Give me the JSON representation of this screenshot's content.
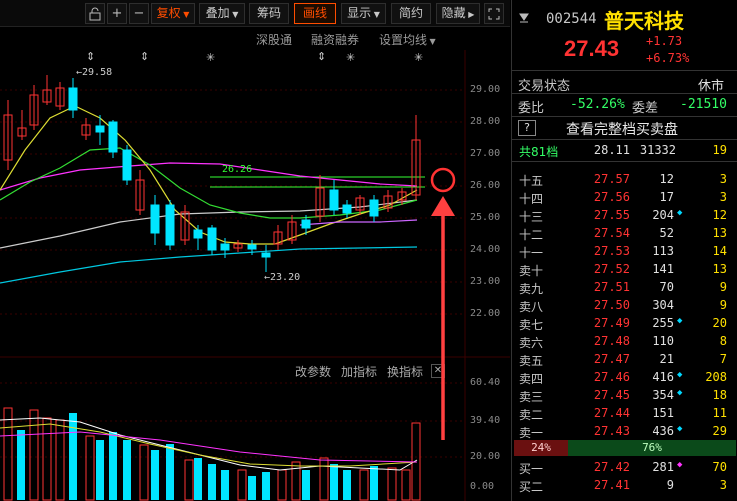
{
  "toolbar": {
    "buttons": [
      "复权",
      "叠加",
      "筹码",
      "画线",
      "显示",
      "简约",
      "隐藏"
    ],
    "active": "画线",
    "sub_buttons": [
      "深股通",
      "融资融券",
      "设置均线"
    ]
  },
  "price_axis": [
    "29.00",
    "28.00",
    "27.00",
    "26.00",
    "25.00",
    "24.00",
    "23.00",
    "22.00"
  ],
  "volume_axis": [
    "60.40",
    "39.40",
    "20.00",
    "0.00"
  ],
  "chart_annotations": {
    "high": "←29.58",
    "low": "←23.20",
    "line_level": "26.26"
  },
  "indicator_buttons": [
    "改参数",
    "加指标",
    "换指标"
  ],
  "stock": {
    "code": "002544",
    "name": "普天科技",
    "price": "27.43",
    "change": "+1.73",
    "change_pct": "+6.73%"
  },
  "status": {
    "label": "交易状态",
    "value": "休市"
  },
  "ratio": {
    "label": "委比",
    "value": "-52.26%",
    "diff_label": "委差",
    "diff_value": "-21510"
  },
  "full_orderbook_link": "查看完整档买卖盘",
  "total": {
    "label": "共81档",
    "price": "28.11",
    "volume": "31332",
    "count": "19"
  },
  "asks": [
    {
      "label": "十五",
      "price": "27.57",
      "vol": "12",
      "mark": "",
      "count": "3"
    },
    {
      "label": "十四",
      "price": "27.56",
      "vol": "17",
      "mark": "",
      "count": "3"
    },
    {
      "label": "十三",
      "price": "27.55",
      "vol": "204",
      "mark": "◆",
      "count": "12"
    },
    {
      "label": "十二",
      "price": "27.54",
      "vol": "52",
      "mark": "",
      "count": "13"
    },
    {
      "label": "十一",
      "price": "27.53",
      "vol": "113",
      "mark": "",
      "count": "14"
    },
    {
      "label": "卖十",
      "price": "27.52",
      "vol": "141",
      "mark": "",
      "count": "13"
    },
    {
      "label": "卖九",
      "price": "27.51",
      "vol": "70",
      "mark": "",
      "count": "9"
    },
    {
      "label": "卖八",
      "price": "27.50",
      "vol": "304",
      "mark": "",
      "count": "9"
    },
    {
      "label": "卖七",
      "price": "27.49",
      "vol": "255",
      "mark": "◆",
      "count": "20"
    },
    {
      "label": "卖六",
      "price": "27.48",
      "vol": "110",
      "mark": "",
      "count": "8"
    },
    {
      "label": "卖五",
      "price": "27.47",
      "vol": "21",
      "mark": "",
      "count": "7"
    },
    {
      "label": "卖四",
      "price": "27.46",
      "vol": "416",
      "mark": "◆",
      "count": "208"
    },
    {
      "label": "卖三",
      "price": "27.45",
      "vol": "354",
      "mark": "◆",
      "count": "18"
    },
    {
      "label": "卖二",
      "price": "27.44",
      "vol": "151",
      "mark": "",
      "count": "11"
    },
    {
      "label": "卖一",
      "price": "27.43",
      "vol": "436",
      "mark": "◆",
      "count": "29"
    }
  ],
  "split_bar": {
    "left": "24%",
    "right": "76%"
  },
  "bids": [
    {
      "label": "买一",
      "price": "27.42",
      "vol": "281",
      "mark": "◆",
      "count": "70"
    },
    {
      "label": "买二",
      "price": "27.41",
      "vol": "9",
      "mark": "",
      "count": "3"
    }
  ],
  "colors": {
    "up": "#ff3333",
    "down": "#00e5ff",
    "accent": "#ff4d00"
  }
}
